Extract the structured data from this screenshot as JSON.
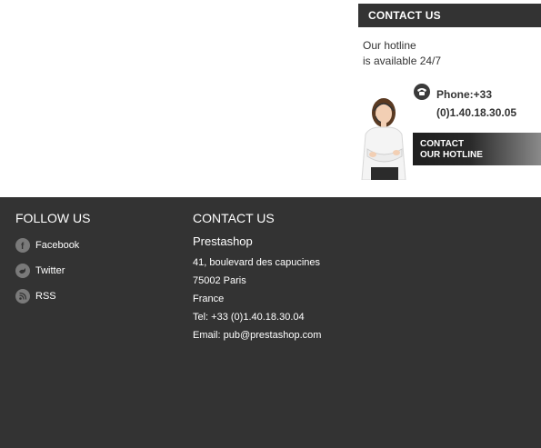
{
  "contact_block": {
    "title": "CONTACT US",
    "hotline_line1": "Our hotline",
    "hotline_line2": "is available 24/7",
    "phone_line1": "Phone:+33",
    "phone_line2": "(0)1.40.18.30.05",
    "button_line1": "CONTACT",
    "button_line2": "OUR HOTLINE"
  },
  "footer": {
    "follow_title": "FOLLOW US",
    "social": [
      {
        "label": "Facebook",
        "icon": "facebook-icon"
      },
      {
        "label": "Twitter",
        "icon": "twitter-icon"
      },
      {
        "label": "RSS",
        "icon": "rss-icon"
      }
    ],
    "contact_title": "CONTACT US",
    "company": "Prestashop",
    "address": [
      "41, boulevard des capucines",
      "75002 Paris",
      "France",
      "Tel: +33 (0)1.40.18.30.04",
      "Email: pub@prestashop.com"
    ]
  },
  "colors": {
    "footer_bg": "#333333",
    "title_bar_bg": "#333333",
    "icon_bg": "#7a7a7a"
  }
}
